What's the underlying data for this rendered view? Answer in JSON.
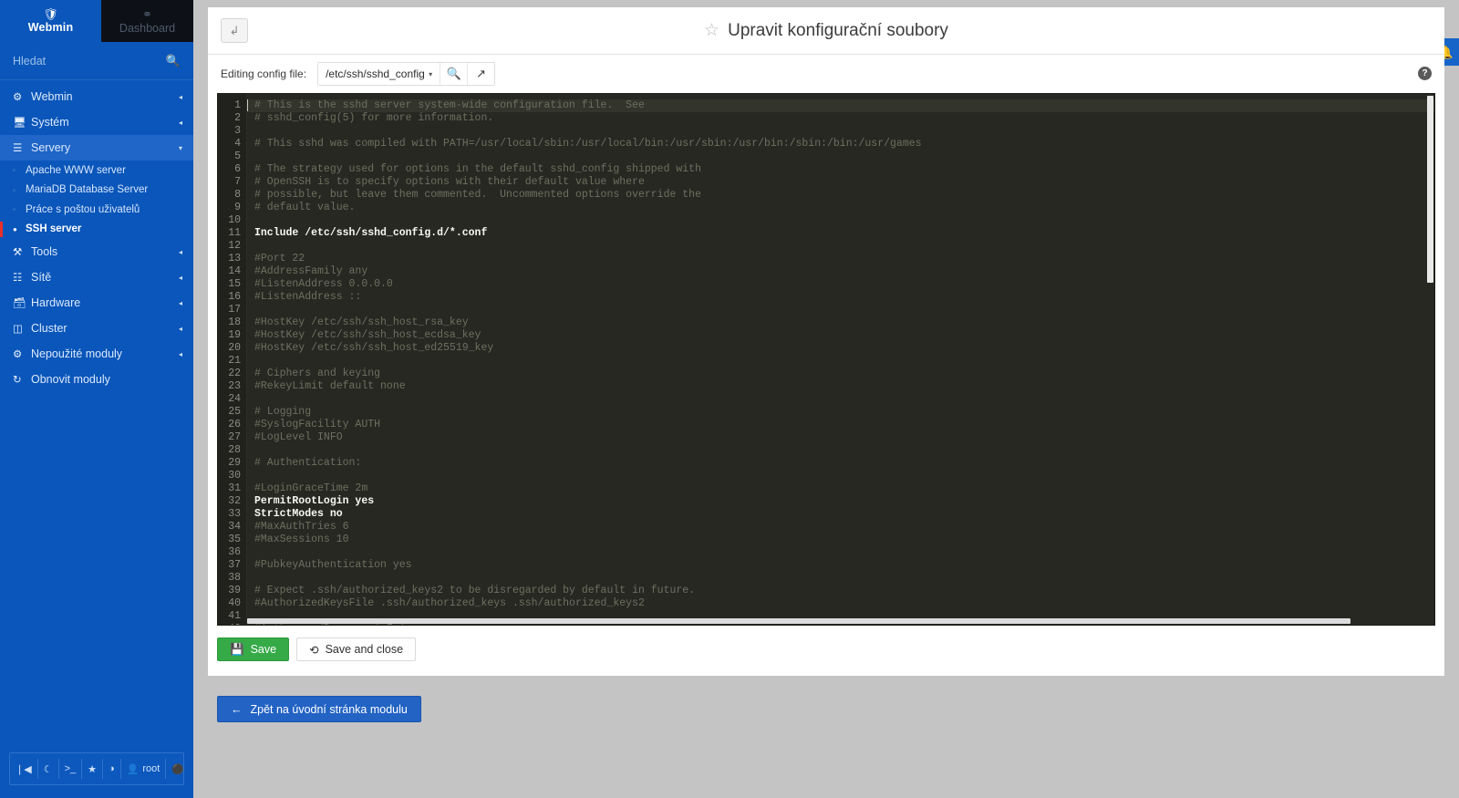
{
  "sidebar": {
    "brand": {
      "label": "Webmin",
      "icon": "webmin-logo-icon"
    },
    "dashboard_tab": {
      "label": "Dashboard",
      "icon": "gauge-icon"
    },
    "search": {
      "placeholder": "Hledat",
      "value": "",
      "icon": "search-icon"
    },
    "items": [
      {
        "label": "Webmin",
        "icon": "gear-icon",
        "caret": "◂",
        "open": false
      },
      {
        "label": "Systém",
        "icon": "monitor-icon",
        "caret": "◂",
        "open": false
      },
      {
        "label": "Servery",
        "icon": "servers-icon",
        "caret": "▾",
        "open": true
      },
      {
        "label": "Tools",
        "icon": "tools-icon",
        "caret": "◂",
        "open": false
      },
      {
        "label": "Sítě",
        "icon": "network-icon",
        "caret": "◂",
        "open": false
      },
      {
        "label": "Hardware",
        "icon": "hardware-icon",
        "caret": "◂",
        "open": false
      },
      {
        "label": "Cluster",
        "icon": "cluster-icon",
        "caret": "◂",
        "open": false
      },
      {
        "label": "Nepoužité moduly",
        "icon": "unused-modules-icon",
        "caret": "◂",
        "open": false
      },
      {
        "label": "Obnovit moduly",
        "icon": "refresh-icon",
        "caret": "",
        "open": false
      }
    ],
    "sub_items": [
      {
        "label": "Apache WWW server",
        "active": false
      },
      {
        "label": "MariaDB Database Server",
        "active": false
      },
      {
        "label": "Práce s poštou uživatelů",
        "active": false
      },
      {
        "label": "SSH server",
        "active": true
      }
    ],
    "tools": [
      {
        "name": "collapse-sidebar-icon",
        "glyph": "❘◀"
      },
      {
        "name": "night-mode-icon",
        "glyph": "☾"
      },
      {
        "name": "terminal-icon",
        "glyph": ">_"
      },
      {
        "name": "favorites-icon",
        "glyph": "★"
      },
      {
        "name": "theme-icon",
        "glyph": "◑"
      },
      {
        "name": "user-icon",
        "glyph": "♟",
        "label": "root"
      },
      {
        "name": "logout-icon",
        "glyph": "⏻"
      }
    ]
  },
  "header": {
    "back_button_icon": "back-arrow-icon",
    "star_icon": "favorite-star-icon",
    "title": "Upravit konfigurační soubory",
    "help_icon_label": "?",
    "bell_icon": "notification-bell-icon"
  },
  "toolbar": {
    "label": "Editing config file:",
    "selected_file": "/etc/ssh/sshd_config",
    "file_options": [
      "/etc/ssh/sshd_config"
    ],
    "caret": "▾",
    "view_icon": "file-search-icon",
    "open_icon": "external-link-icon"
  },
  "editor": {
    "language": "sshd-config",
    "active_line": 1,
    "total_visible_lines": 42,
    "lines": [
      {
        "n": 1,
        "text": "# This is the sshd server system-wide configuration file.  See",
        "style": "cmt"
      },
      {
        "n": 2,
        "text": "# sshd_config(5) for more information.",
        "style": "cmt"
      },
      {
        "n": 3,
        "text": "",
        "style": "cmt"
      },
      {
        "n": 4,
        "text": "# This sshd was compiled with PATH=/usr/local/sbin:/usr/local/bin:/usr/sbin:/usr/bin:/sbin:/bin:/usr/games",
        "style": "cmt"
      },
      {
        "n": 5,
        "text": "",
        "style": "cmt"
      },
      {
        "n": 6,
        "text": "# The strategy used for options in the default sshd_config shipped with",
        "style": "cmt"
      },
      {
        "n": 7,
        "text": "# OpenSSH is to specify options with their default value where",
        "style": "cmt"
      },
      {
        "n": 8,
        "text": "# possible, but leave them commented.  Uncommented options override the",
        "style": "cmt"
      },
      {
        "n": 9,
        "text": "# default value.",
        "style": "cmt"
      },
      {
        "n": 10,
        "text": "",
        "style": "cmt"
      },
      {
        "n": 11,
        "text": "Include /etc/ssh/sshd_config.d/*.conf",
        "style": "kw"
      },
      {
        "n": 12,
        "text": "",
        "style": "cmt"
      },
      {
        "n": 13,
        "text": "#Port 22",
        "style": "cmt"
      },
      {
        "n": 14,
        "text": "#AddressFamily any",
        "style": "cmt"
      },
      {
        "n": 15,
        "text": "#ListenAddress 0.0.0.0",
        "style": "cmt"
      },
      {
        "n": 16,
        "text": "#ListenAddress ::",
        "style": "cmt"
      },
      {
        "n": 17,
        "text": "",
        "style": "cmt"
      },
      {
        "n": 18,
        "text": "#HostKey /etc/ssh/ssh_host_rsa_key",
        "style": "cmt"
      },
      {
        "n": 19,
        "text": "#HostKey /etc/ssh/ssh_host_ecdsa_key",
        "style": "cmt"
      },
      {
        "n": 20,
        "text": "#HostKey /etc/ssh/ssh_host_ed25519_key",
        "style": "cmt"
      },
      {
        "n": 21,
        "text": "",
        "style": "cmt"
      },
      {
        "n": 22,
        "text": "# Ciphers and keying",
        "style": "cmt"
      },
      {
        "n": 23,
        "text": "#RekeyLimit default none",
        "style": "cmt"
      },
      {
        "n": 24,
        "text": "",
        "style": "cmt"
      },
      {
        "n": 25,
        "text": "# Logging",
        "style": "cmt"
      },
      {
        "n": 26,
        "text": "#SyslogFacility AUTH",
        "style": "cmt"
      },
      {
        "n": 27,
        "text": "#LogLevel INFO",
        "style": "cmt"
      },
      {
        "n": 28,
        "text": "",
        "style": "cmt"
      },
      {
        "n": 29,
        "text": "# Authentication:",
        "style": "cmt"
      },
      {
        "n": 30,
        "text": "",
        "style": "cmt"
      },
      {
        "n": 31,
        "text": "#LoginGraceTime 2m",
        "style": "cmt"
      },
      {
        "n": 32,
        "text": "PermitRootLogin yes",
        "style": "kw"
      },
      {
        "n": 33,
        "text": "StrictModes no",
        "style": "kw"
      },
      {
        "n": 34,
        "text": "#MaxAuthTries 6",
        "style": "cmt"
      },
      {
        "n": 35,
        "text": "#MaxSessions 10",
        "style": "cmt"
      },
      {
        "n": 36,
        "text": "",
        "style": "cmt"
      },
      {
        "n": 37,
        "text": "#PubkeyAuthentication yes",
        "style": "cmt"
      },
      {
        "n": 38,
        "text": "",
        "style": "cmt"
      },
      {
        "n": 39,
        "text": "# Expect .ssh/authorized_keys2 to be disregarded by default in future.",
        "style": "cmt"
      },
      {
        "n": 40,
        "text": "#AuthorizedKeysFile .ssh/authorized_keys .ssh/authorized_keys2",
        "style": "cmt"
      },
      {
        "n": 41,
        "text": "",
        "style": "cmt"
      },
      {
        "n": 42,
        "text": "#AuthorizedPrincipalsFile none",
        "style": "cmt"
      }
    ]
  },
  "actions": {
    "save_label": "Save",
    "save_icon": "floppy-disk-icon",
    "save_and_close_label": "Save and close",
    "save_and_close_icon": "circle-arrow-icon",
    "return_label": "Zpět na úvodní stránka modulu",
    "return_icon": "arrow-left-icon"
  },
  "colors": {
    "sidebar_bg": "#0a56ba",
    "sidebar_active": "#1f66c8",
    "accent_red": "#e8302a",
    "editor_bg": "#272822",
    "gutter_bg": "#21221d",
    "save_green": "#35aa47",
    "return_blue": "#2263c4"
  }
}
